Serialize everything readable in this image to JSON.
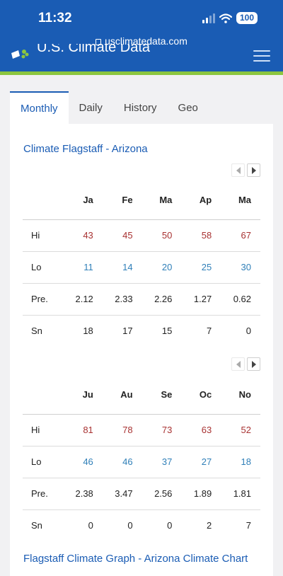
{
  "status": {
    "time": "11:32",
    "battery": "100"
  },
  "browser": {
    "url": "usclimatedata.com"
  },
  "site": {
    "title": "U.S. Climate Data"
  },
  "tabs": [
    {
      "label": "Monthly",
      "active": true
    },
    {
      "label": "Daily",
      "active": false
    },
    {
      "label": "History",
      "active": false
    },
    {
      "label": "Geo",
      "active": false
    }
  ],
  "section": {
    "title": "Climate Flagstaff - Arizona"
  },
  "row_labels": {
    "hi": "Hi",
    "lo": "Lo",
    "pre": "Pre.",
    "sn": "Sn"
  },
  "table1": {
    "months": [
      "Ja",
      "Fe",
      "Ma",
      "Ap",
      "Ma"
    ],
    "hi": [
      "43",
      "45",
      "50",
      "58",
      "67"
    ],
    "lo": [
      "11",
      "14",
      "20",
      "25",
      "30"
    ],
    "pre": [
      "2.12",
      "2.33",
      "2.26",
      "1.27",
      "0.62"
    ],
    "sn": [
      "18",
      "17",
      "15",
      "7",
      "0"
    ]
  },
  "table2": {
    "months": [
      "Ju",
      "Au",
      "Se",
      "Oc",
      "No"
    ],
    "hi": [
      "81",
      "78",
      "73",
      "63",
      "52"
    ],
    "lo": [
      "46",
      "46",
      "37",
      "27",
      "18"
    ],
    "pre": [
      "2.38",
      "3.47",
      "2.56",
      "1.89",
      "1.81"
    ],
    "sn": [
      "0",
      "0",
      "0",
      "2",
      "7"
    ]
  },
  "graph_section": {
    "title": "Flagstaff Climate Graph - Arizona Climate Chart"
  },
  "colors": {
    "brand": "#1a5cb4",
    "accent_green": "#8cc63f",
    "high_temp": "#a83232",
    "low_temp": "#2f7fb8"
  }
}
